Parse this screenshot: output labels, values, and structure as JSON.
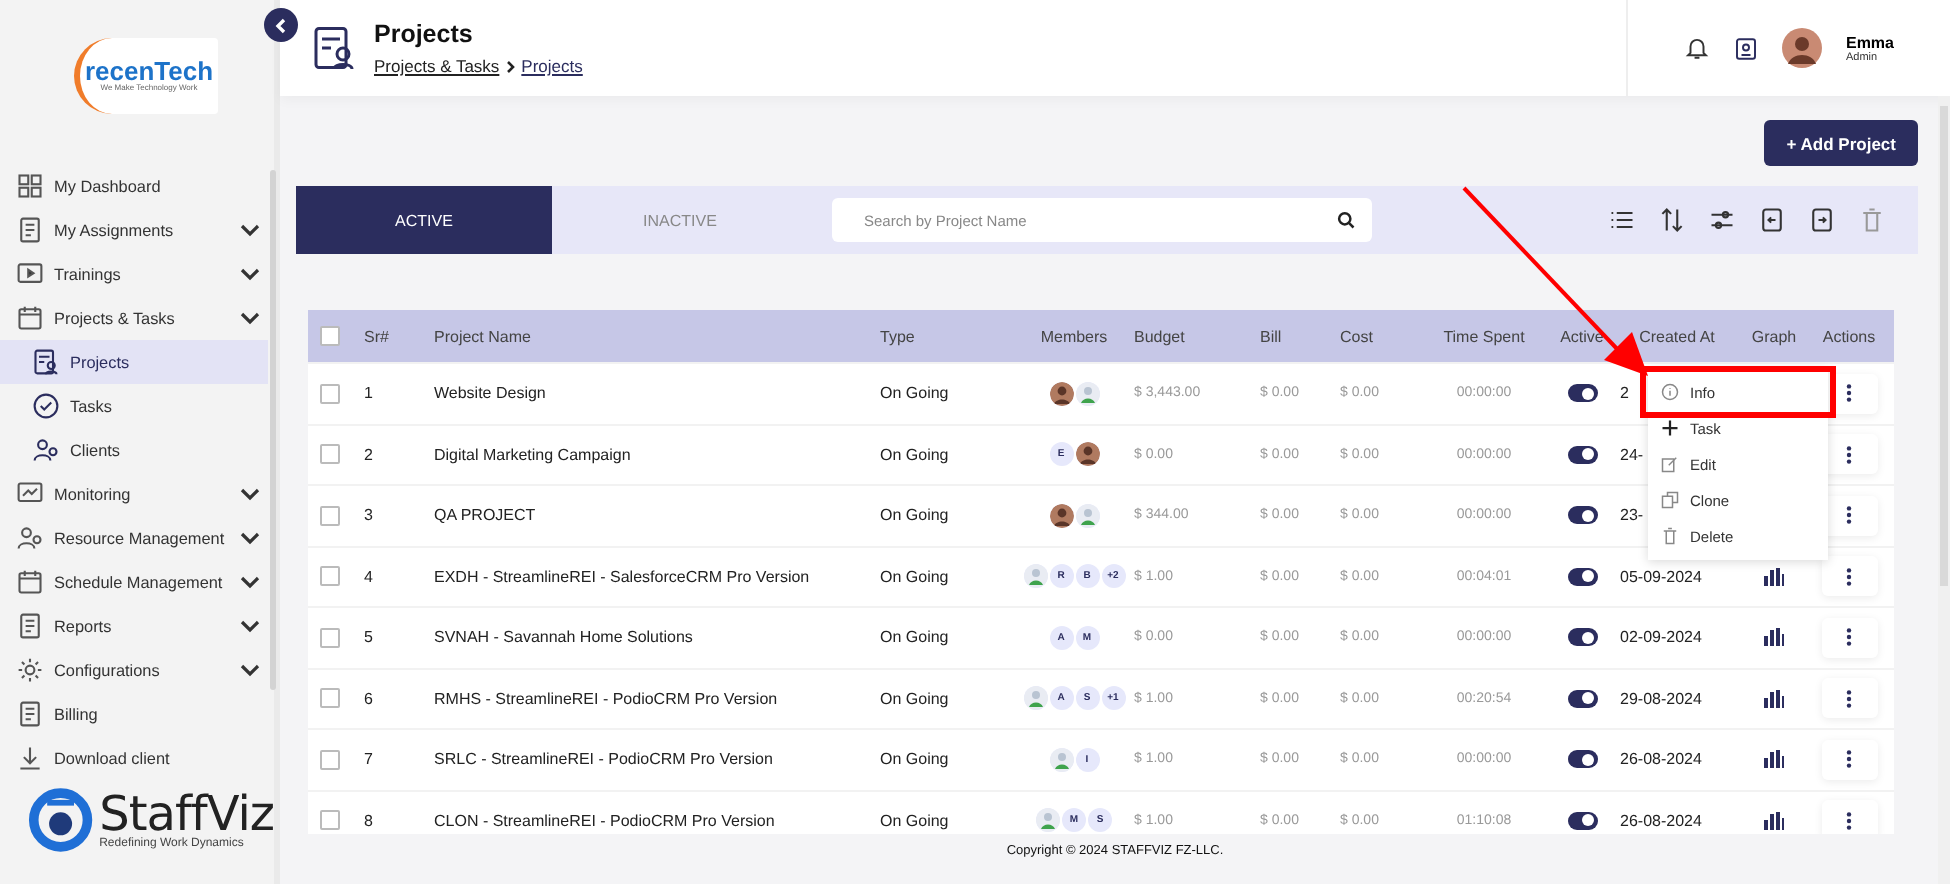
{
  "sidebar": {
    "logo": {
      "name": "recenTech",
      "tagline": "We Make Technology Work"
    },
    "items": [
      {
        "label": "My Dashboard",
        "expandable": false,
        "selected": false
      },
      {
        "label": "My Assignments",
        "expandable": true,
        "selected": false
      },
      {
        "label": "Trainings",
        "expandable": true,
        "selected": false
      },
      {
        "label": "Projects & Tasks",
        "expandable": true,
        "selected": false,
        "children": [
          {
            "label": "Projects",
            "selected": true
          },
          {
            "label": "Tasks",
            "selected": false
          },
          {
            "label": "Clients",
            "selected": false
          }
        ]
      },
      {
        "label": "Monitoring",
        "expandable": true,
        "selected": false
      },
      {
        "label": "Resource Management",
        "expandable": true,
        "selected": false
      },
      {
        "label": "Schedule Management",
        "expandable": true,
        "selected": false
      },
      {
        "label": "Reports",
        "expandable": true,
        "selected": false
      },
      {
        "label": "Configurations",
        "expandable": true,
        "selected": false
      },
      {
        "label": "Billing",
        "expandable": false,
        "selected": false
      },
      {
        "label": "Download client",
        "expandable": false,
        "selected": false
      }
    ],
    "brand": {
      "name": "StaffViz",
      "tagline": "Redefining Work Dynamics"
    }
  },
  "header": {
    "title": "Projects",
    "breadcrumb": [
      "Projects & Tasks",
      "Projects"
    ],
    "user": {
      "name": "Emma",
      "role": "Admin"
    }
  },
  "add_button": "+ Add Project",
  "tabs": [
    {
      "label": "ACTIVE",
      "selected": true
    },
    {
      "label": "INACTIVE",
      "selected": false
    }
  ],
  "search": {
    "placeholder": "Search by Project Name"
  },
  "table": {
    "header_checked": false,
    "columns": [
      "Sr#",
      "Project Name",
      "Type",
      "Members",
      "Budget",
      "Bill",
      "Cost",
      "Time Spent",
      "Active",
      "Created At",
      "Graph",
      "Actions"
    ],
    "rows": [
      {
        "sr": "1",
        "name": "Website Design",
        "type": "On Going",
        "members": [
          {
            "kind": "photo"
          },
          {
            "kind": "generic"
          }
        ],
        "budget": "$ 3,443.00",
        "bill": "$ 0.00",
        "cost": "$ 0.00",
        "time": "00:00:00",
        "active": true,
        "created": "2",
        "graph": false,
        "checked": false
      },
      {
        "sr": "2",
        "name": "Digital Marketing Campaign",
        "type": "On Going",
        "members": [
          {
            "kind": "letter",
            "text": "E"
          },
          {
            "kind": "photo"
          }
        ],
        "budget": "$ 0.00",
        "bill": "$ 0.00",
        "cost": "$ 0.00",
        "time": "00:00:00",
        "active": true,
        "created": "24-",
        "graph": false,
        "checked": false
      },
      {
        "sr": "3",
        "name": "QA PROJECT",
        "type": "On Going",
        "members": [
          {
            "kind": "photo"
          },
          {
            "kind": "generic"
          }
        ],
        "budget": "$ 344.00",
        "bill": "$ 0.00",
        "cost": "$ 0.00",
        "time": "00:00:00",
        "active": true,
        "created": "23-",
        "graph": false,
        "checked": false
      },
      {
        "sr": "4",
        "name": "EXDH - StreamlineREI - SalesforceCRM Pro Version",
        "type": "On Going",
        "members": [
          {
            "kind": "generic"
          },
          {
            "kind": "letter",
            "text": "R"
          },
          {
            "kind": "letter",
            "text": "B"
          },
          {
            "kind": "letter",
            "text": "+2"
          }
        ],
        "budget": "$ 1.00",
        "bill": "$ 0.00",
        "cost": "$ 0.00",
        "time": "00:04:01",
        "active": true,
        "created": "05-09-2024",
        "graph": true,
        "checked": false
      },
      {
        "sr": "5",
        "name": "SVNAH - Savannah Home Solutions",
        "type": "On Going",
        "members": [
          {
            "kind": "letter",
            "text": "A"
          },
          {
            "kind": "letter",
            "text": "M"
          }
        ],
        "budget": "$ 0.00",
        "bill": "$ 0.00",
        "cost": "$ 0.00",
        "time": "00:00:00",
        "active": true,
        "created": "02-09-2024",
        "graph": true,
        "checked": false
      },
      {
        "sr": "6",
        "name": "RMHS - StreamlineREI - PodioCRM Pro Version",
        "type": "On Going",
        "members": [
          {
            "kind": "generic"
          },
          {
            "kind": "letter",
            "text": "A"
          },
          {
            "kind": "letter",
            "text": "S"
          },
          {
            "kind": "letter",
            "text": "+1"
          }
        ],
        "budget": "$ 1.00",
        "bill": "$ 0.00",
        "cost": "$ 0.00",
        "time": "00:20:54",
        "active": true,
        "created": "29-08-2024",
        "graph": true,
        "checked": false
      },
      {
        "sr": "7",
        "name": "SRLC - StreamlineREI - PodioCRM Pro Version",
        "type": "On Going",
        "members": [
          {
            "kind": "generic"
          },
          {
            "kind": "letter",
            "text": "I"
          }
        ],
        "budget": "$ 1.00",
        "bill": "$ 0.00",
        "cost": "$ 0.00",
        "time": "00:00:00",
        "active": true,
        "created": "26-08-2024",
        "graph": true,
        "checked": false
      },
      {
        "sr": "8",
        "name": "CLON - StreamlineREI - PodioCRM Pro Version",
        "type": "On Going",
        "members": [
          {
            "kind": "generic"
          },
          {
            "kind": "letter",
            "text": "M"
          },
          {
            "kind": "letter",
            "text": "S"
          }
        ],
        "budget": "$ 1.00",
        "bill": "$ 0.00",
        "cost": "$ 0.00",
        "time": "01:10:08",
        "active": true,
        "created": "26-08-2024",
        "graph": true,
        "checked": false
      }
    ]
  },
  "action_menu": [
    {
      "label": "Info",
      "highlighted": true
    },
    {
      "label": "Task",
      "highlighted": false
    },
    {
      "label": "Edit",
      "highlighted": false
    },
    {
      "label": "Clone",
      "highlighted": false
    },
    {
      "label": "Delete",
      "highlighted": false
    }
  ],
  "footer": "Copyright © 2024 STAFFVIZ FZ-LLC."
}
